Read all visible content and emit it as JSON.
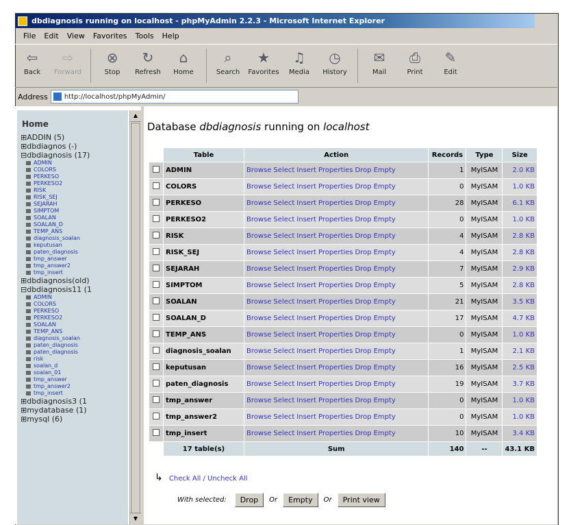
{
  "window": {
    "title": "dbdiagnosis running on localhost - phpMyAdmin 2.2.3 - Microsoft Internet Explorer"
  },
  "menu": [
    "File",
    "Edit",
    "View",
    "Favorites",
    "Tools",
    "Help"
  ],
  "toolbar": [
    {
      "label": "Back",
      "icon": "back-arrow-icon",
      "glyph": "⇦",
      "disabled": false
    },
    {
      "label": "Forward",
      "icon": "forward-arrow-icon",
      "glyph": "⇨",
      "disabled": true
    },
    {
      "label": "Stop",
      "icon": "stop-icon",
      "glyph": "⊗",
      "disabled": false
    },
    {
      "label": "Refresh",
      "icon": "refresh-icon",
      "glyph": "↻",
      "disabled": false
    },
    {
      "label": "Home",
      "icon": "home-icon",
      "glyph": "⌂",
      "disabled": false
    },
    {
      "label": "Search",
      "icon": "search-icon",
      "glyph": "⌕",
      "disabled": false
    },
    {
      "label": "Favorites",
      "icon": "favorites-icon",
      "glyph": "★",
      "disabled": false
    },
    {
      "label": "Media",
      "icon": "media-icon",
      "glyph": "♫",
      "disabled": false
    },
    {
      "label": "History",
      "icon": "history-icon",
      "glyph": "◷",
      "disabled": false
    },
    {
      "label": "Mail",
      "icon": "mail-icon",
      "glyph": "✉",
      "disabled": false
    },
    {
      "label": "Print",
      "icon": "print-icon",
      "glyph": "⎙",
      "disabled": false
    },
    {
      "label": "Edit",
      "icon": "edit-icon",
      "glyph": "✎",
      "disabled": false
    }
  ],
  "address": {
    "label": "Address",
    "url": "http://localhost/phpMyAdmin/"
  },
  "left": {
    "home": "Home",
    "databases": [
      {
        "name": "ADDIN",
        "count": "(5)",
        "open": false,
        "tables": []
      },
      {
        "name": "dbdiagnos",
        "count": "(-)",
        "open": false,
        "tables": []
      },
      {
        "name": "dbdiagnosis",
        "count": "(17)",
        "open": true,
        "tables": [
          "ADMIN",
          "COLORS",
          "PERKESO",
          "PERKESO2",
          "RISK",
          "RISK_SEJ",
          "SEJARAH",
          "SIMPTOM",
          "SOALAN",
          "SOALAN_D",
          "TEMP_ANS",
          "diagnosis_soalan",
          "keputusan",
          "paten_diagnosis",
          "tmp_answer",
          "tmp_answer2",
          "tmp_insert"
        ]
      },
      {
        "name": "dbdiagnosis(old)",
        "count": "",
        "open": false,
        "tables": []
      },
      {
        "name": "dbdiagnosis11",
        "count": "(1",
        "open": true,
        "tables": [
          "ADMIN",
          "COLORS",
          "PERKESO",
          "PERKESO2",
          "SOALAN",
          "TEMP_ANS",
          "diagnosis_soalan",
          "paten_diagnosis",
          "paten_diagnosis",
          "risk",
          "soalan_d",
          "soalan_01",
          "tmp_answer",
          "tmp_answer2",
          "tmp_insert"
        ]
      },
      {
        "name": "dbdiagnosis3",
        "count": "(1",
        "open": false,
        "tables": []
      },
      {
        "name": "mydatabase",
        "count": "(1)",
        "open": false,
        "tables": []
      },
      {
        "name": "mysql",
        "count": "(6)",
        "open": false,
        "tables": []
      }
    ]
  },
  "main": {
    "title_prefix": "Database ",
    "db_name": "dbdiagnosis",
    "title_mid": " running on ",
    "host": "localhost",
    "headers": {
      "table": "Table",
      "action": "Action",
      "records": "Records",
      "type": "Type",
      "size": "Size"
    },
    "actions": [
      "Browse",
      "Select",
      "Insert",
      "Properties",
      "Drop",
      "Empty"
    ],
    "rows": [
      {
        "name": "ADMIN",
        "records": "1",
        "type": "MyISAM",
        "size": "2.0 KB"
      },
      {
        "name": "COLORS",
        "records": "0",
        "type": "MyISAM",
        "size": "1.0 KB"
      },
      {
        "name": "PERKESO",
        "records": "28",
        "type": "MyISAM",
        "size": "6.1 KB"
      },
      {
        "name": "PERKESO2",
        "records": "0",
        "type": "MyISAM",
        "size": "1.0 KB"
      },
      {
        "name": "RISK",
        "records": "4",
        "type": "MyISAM",
        "size": "2.8 KB"
      },
      {
        "name": "RISK_SEJ",
        "records": "4",
        "type": "MyISAM",
        "size": "2.8 KB"
      },
      {
        "name": "SEJARAH",
        "records": "7",
        "type": "MyISAM",
        "size": "2.9 KB"
      },
      {
        "name": "SIMPTOM",
        "records": "5",
        "type": "MyISAM",
        "size": "2.8 KB"
      },
      {
        "name": "SOALAN",
        "records": "21",
        "type": "MyISAM",
        "size": "3.5 KB"
      },
      {
        "name": "SOALAN_D",
        "records": "17",
        "type": "MyISAM",
        "size": "4.7 KB"
      },
      {
        "name": "TEMP_ANS",
        "records": "0",
        "type": "MyISAM",
        "size": "1.0 KB"
      },
      {
        "name": "diagnosis_soalan",
        "records": "1",
        "type": "MyISAM",
        "size": "2.1 KB"
      },
      {
        "name": "keputusan",
        "records": "16",
        "type": "MyISAM",
        "size": "2.5 KB"
      },
      {
        "name": "paten_diagnosis",
        "records": "19",
        "type": "MyISAM",
        "size": "3.7 KB"
      },
      {
        "name": "tmp_answer",
        "records": "0",
        "type": "MyISAM",
        "size": "1.0 KB"
      },
      {
        "name": "tmp_answer2",
        "records": "0",
        "type": "MyISAM",
        "size": "1.0 KB"
      },
      {
        "name": "tmp_insert",
        "records": "10",
        "type": "MyISAM",
        "size": "3.4 KB"
      }
    ],
    "summary": {
      "tables": "17 table(s)",
      "sum": "Sum",
      "records": "140",
      "type": "--",
      "size": "43.1 KB"
    },
    "check_all": "Check All",
    "slash": " / ",
    "uncheck_all": "Uncheck All",
    "with_selected": "With selected:",
    "btn_drop": "Drop",
    "or": "Or",
    "btn_empty": "Empty",
    "btn_print": "Print view"
  }
}
